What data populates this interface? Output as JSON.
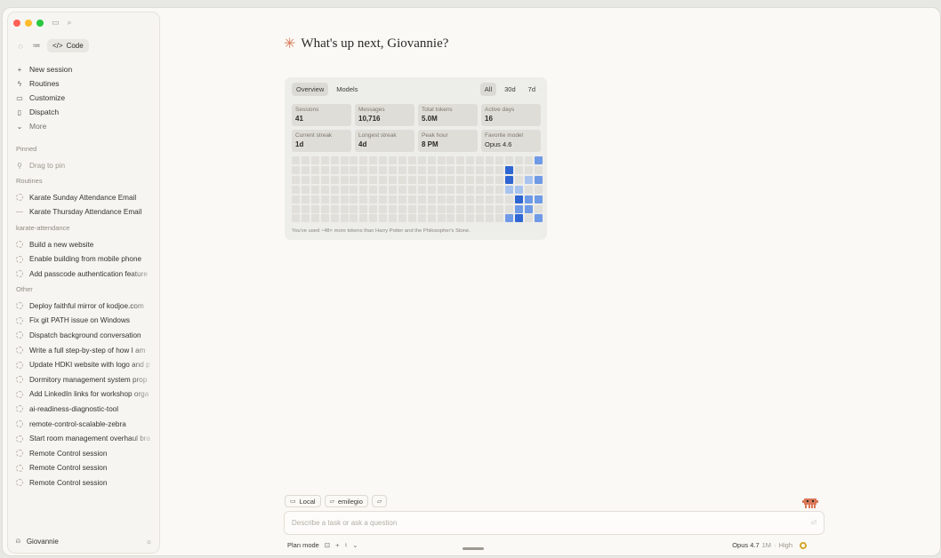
{
  "sidebar": {
    "mode_tab": "Code",
    "nav": [
      {
        "icon": "plus-icon",
        "label": "New session"
      },
      {
        "icon": "bolt-icon",
        "label": "Routines"
      },
      {
        "icon": "briefcase-icon",
        "label": "Customize"
      },
      {
        "icon": "phone-icon",
        "label": "Dispatch"
      },
      {
        "icon": "chevron-down-icon",
        "label": "More"
      }
    ],
    "pinned": {
      "title": "Pinned",
      "placeholder": "Drag to pin"
    },
    "routines": {
      "title": "Routines",
      "items": [
        "Karate Sunday Attendance Email",
        "Karate Thursday Attendance Email"
      ]
    },
    "project": {
      "title": "karate-attendance",
      "items": [
        "Build a new website",
        "Enable building from mobile phone",
        "Add passcode authentication feature"
      ]
    },
    "other": {
      "title": "Other",
      "items": [
        "Deploy faithful mirror of kodjoe.com",
        "Fix git PATH issue on Windows",
        "Dispatch background conversation",
        "Write a full step-by-step of how I am",
        "Update HDKI website with logo and p",
        "Dormitory management system prop",
        "Add LinkedIn links for workshop orga",
        "ai-readiness-diagnostic-tool",
        "remote-control-scalable-zebra",
        "Start room management overhaul bra",
        "Remote Control session",
        "Remote Control session",
        "Remote Control session"
      ]
    },
    "user": "Giovannie"
  },
  "main": {
    "greeting": "What's up next, Giovannie?",
    "stats": {
      "tabs": [
        "Overview",
        "Models"
      ],
      "ranges": [
        "All",
        "30d",
        "7d"
      ],
      "cards": [
        {
          "label": "Sessions",
          "value": "41"
        },
        {
          "label": "Messages",
          "value": "10,716"
        },
        {
          "label": "Total tokens",
          "value": "5.0M"
        },
        {
          "label": "Active days",
          "value": "16"
        },
        {
          "label": "Current streak",
          "value": "1d"
        },
        {
          "label": "Longest streak",
          "value": "4d"
        },
        {
          "label": "Peak hour",
          "value": "8 PM"
        },
        {
          "label": "Favorite model",
          "value": "Opus 4.6"
        }
      ],
      "note": "You've used ~48× more tokens than Harry Potter and the Philosopher's Stone.",
      "activity_colors": {
        "empty": "#e1dfda",
        "light": "#a9c3ef",
        "medium": "#6f9ae6",
        "dark": "#2f66d3"
      }
    },
    "composer": {
      "chips": [
        {
          "icon": "laptop-icon",
          "label": "Local"
        },
        {
          "icon": "folder-icon",
          "label": "emilegio"
        },
        {
          "icon": "folder-add-icon",
          "label": ""
        }
      ],
      "placeholder": "Describe a task or ask a question",
      "plan_mode": "Plan mode",
      "model": "Opus 4.7",
      "context": "1M",
      "effort": "High"
    }
  }
}
